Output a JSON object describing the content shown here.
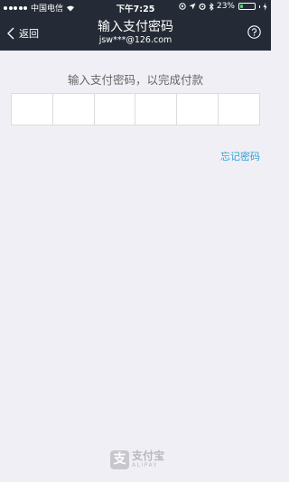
{
  "status_bar": {
    "carrier": "中国电信",
    "time": "下午7:25",
    "battery": "23%",
    "battery_level": 0.23,
    "icons": [
      "signal-icon",
      "wifi-icon",
      "location-icon",
      "alarm-icon",
      "bluetooth-icon",
      "battery-icon",
      "charging-icon"
    ]
  },
  "nav": {
    "back_label": "返回",
    "title": "输入支付密码",
    "subtitle": "jsw***@126.com",
    "help_icon": "help-icon"
  },
  "main": {
    "prompt": "输入支付密码，以完成付款",
    "pin_length": 6,
    "forgot_label": "忘记密码"
  },
  "footer": {
    "logo_glyph": "支",
    "logo_cn": "支付宝",
    "logo_en": "ALIPAY"
  },
  "colors": {
    "header_bg": "#242b36",
    "page_bg": "#f0eff5",
    "link": "#2ea0d7",
    "battery": "#4cd964"
  }
}
